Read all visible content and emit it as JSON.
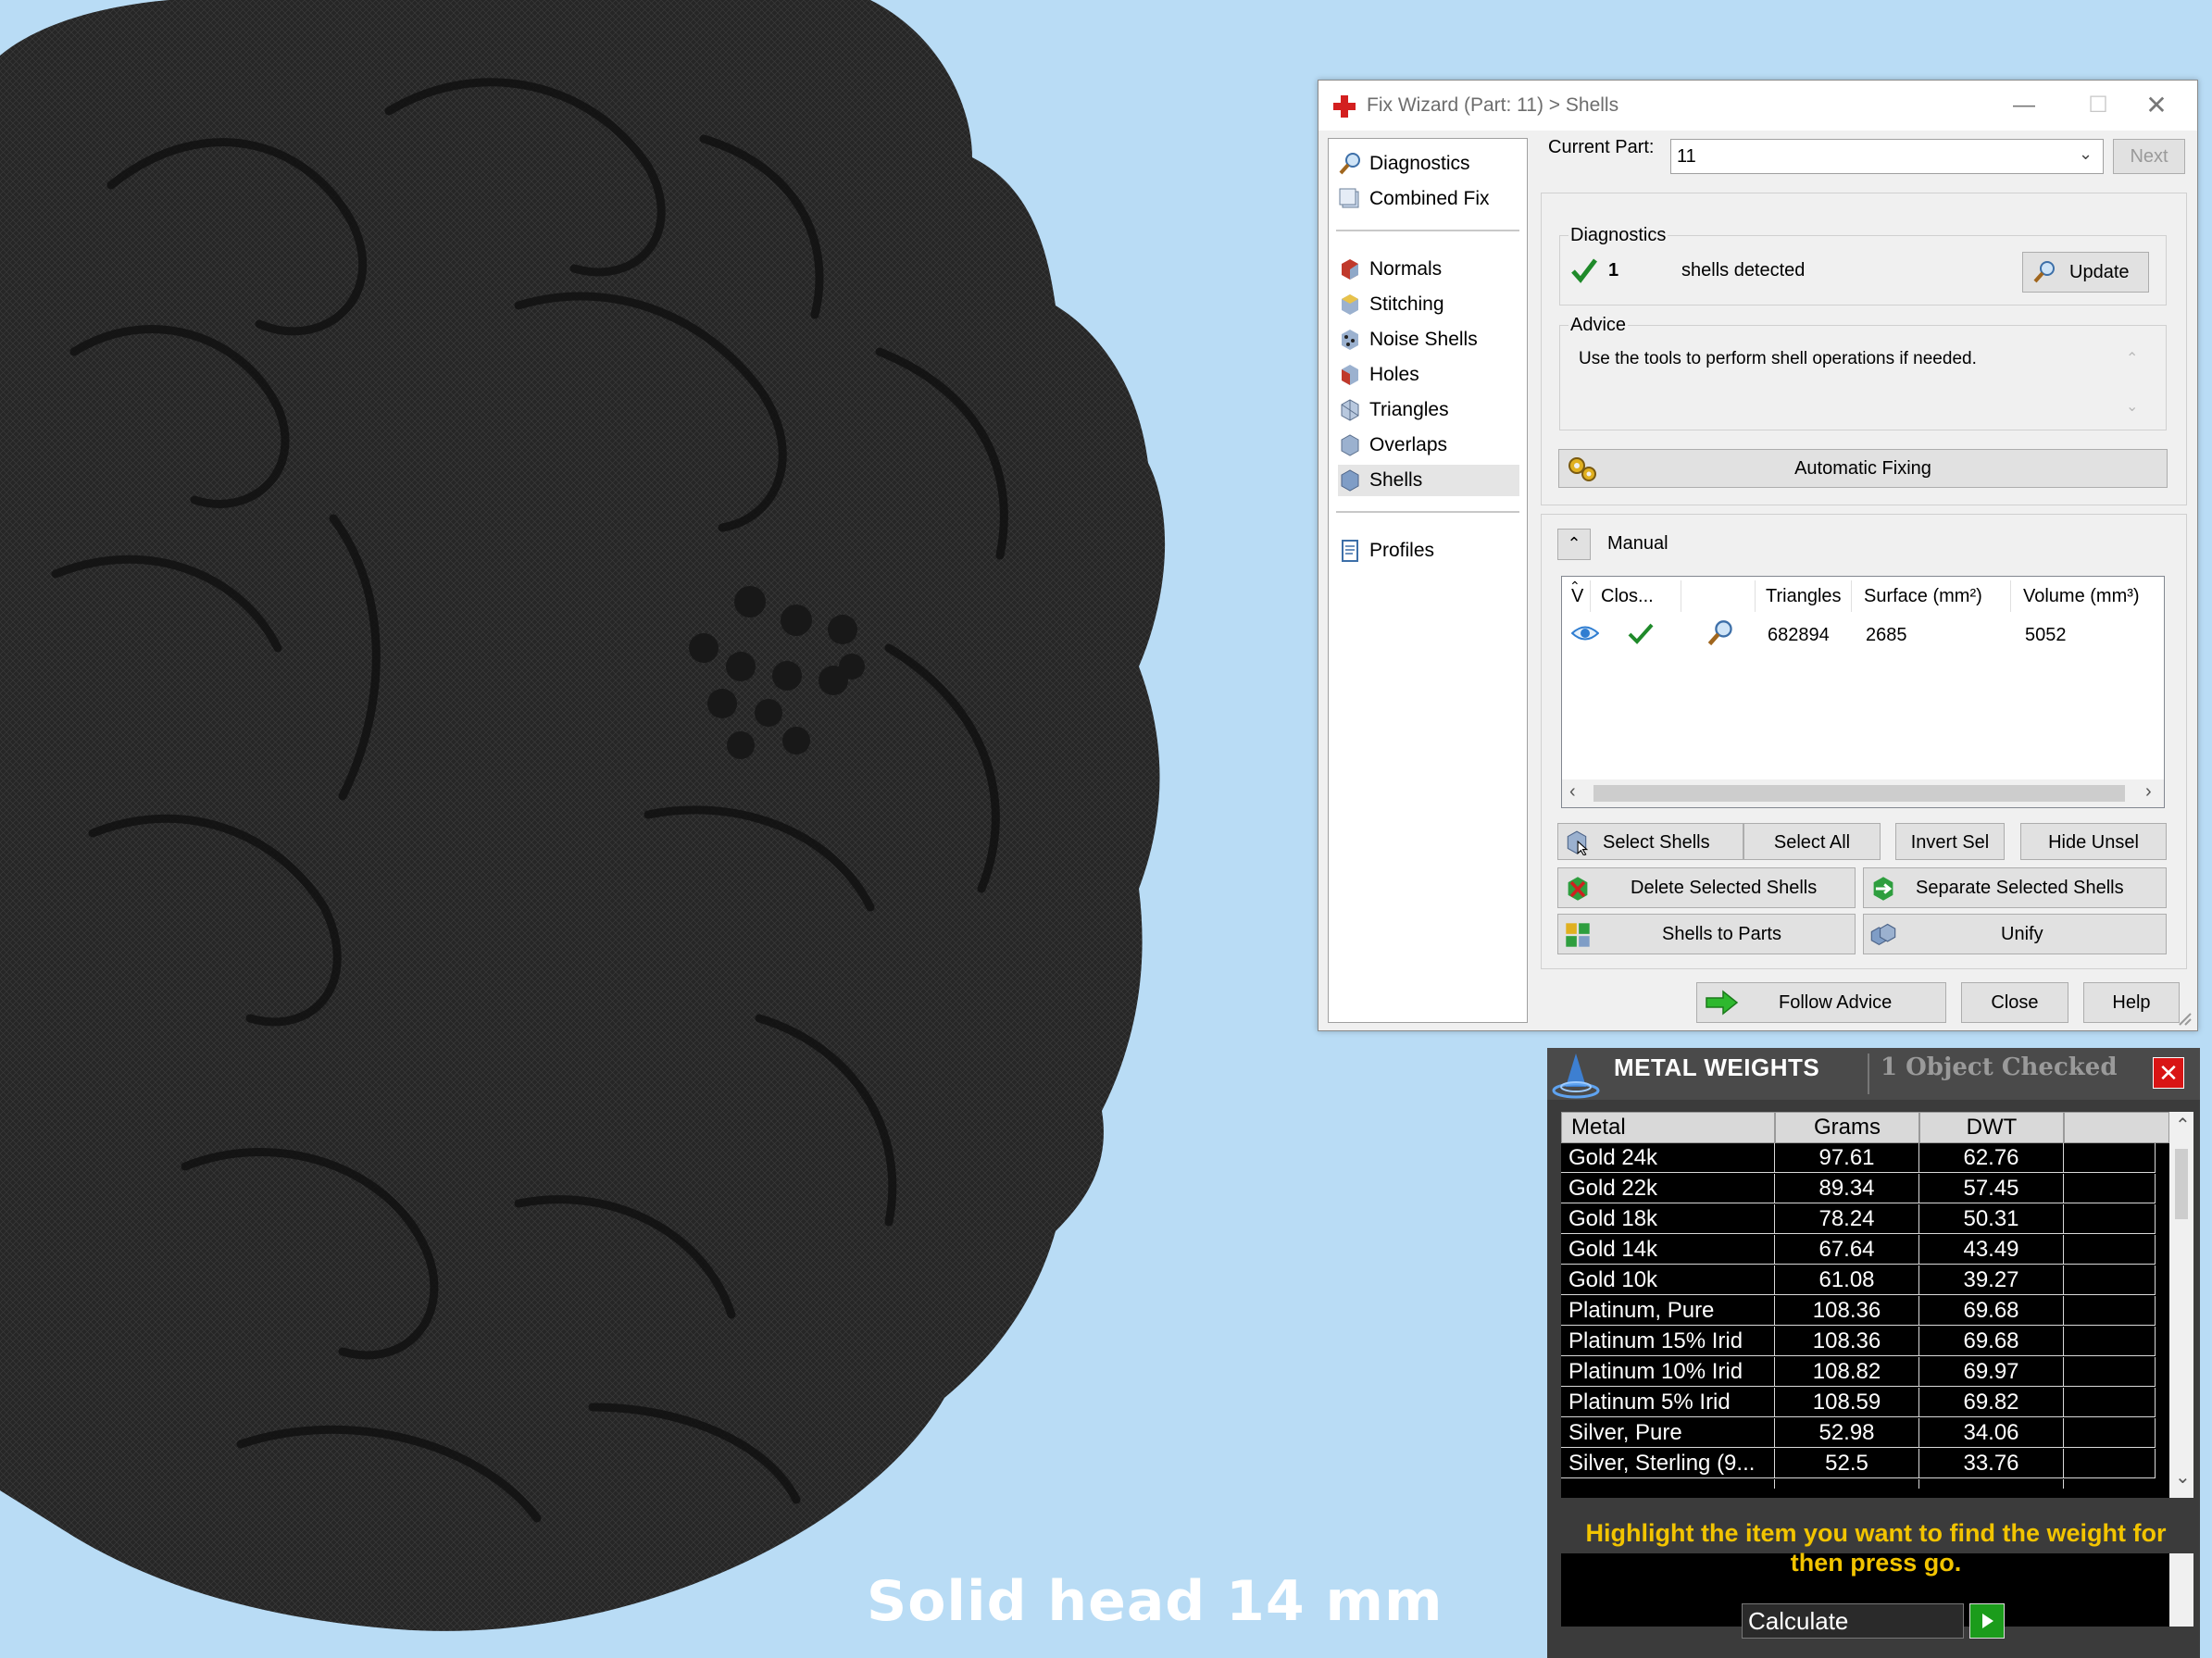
{
  "caption": "Solid head 14 mm",
  "wizard": {
    "title": "Fix Wizard (Part: 11) > Shells",
    "nav": {
      "diagnostics": "Diagnostics",
      "combined_fix": "Combined Fix",
      "normals": "Normals",
      "stitching": "Stitching",
      "noise_shells": "Noise Shells",
      "holes": "Holes",
      "triangles": "Triangles",
      "overlaps": "Overlaps",
      "shells": "Shells",
      "profiles": "Profiles"
    },
    "current_part_label": "Current Part:",
    "current_part_value": "11",
    "next_label": "Next",
    "diagnostics": {
      "title": "Diagnostics",
      "count": "1",
      "text": "shells detected",
      "update_label": "Update"
    },
    "advice": {
      "title": "Advice",
      "text": "Use the tools to perform shell operations if needed."
    },
    "automatic_fixing_label": "Automatic Fixing",
    "manual_label": "Manual",
    "grid": {
      "headers": [
        "V",
        "Clos...",
        "",
        "Triangles",
        "Surface (mm²)",
        "Volume (mm³)"
      ],
      "row": {
        "triangles": "682894",
        "surface": "2685",
        "volume": "5052"
      }
    },
    "buttons": {
      "select_shells": "Select Shells",
      "select_all": "Select All",
      "invert_sel": "Invert Sel",
      "hide_unsel": "Hide Unsel",
      "delete_selected": "Delete Selected Shells",
      "separate_selected": "Separate Selected Shells",
      "shells_to_parts": "Shells to Parts",
      "unify": "Unify",
      "follow_advice": "Follow Advice",
      "close": "Close",
      "help": "Help"
    }
  },
  "metal": {
    "title": "METAL WEIGHTS",
    "checked": "1 Object Checked",
    "headers": [
      "Metal",
      "Grams",
      "DWT"
    ],
    "rows": [
      [
        "Gold 24k",
        "97.61",
        "62.76"
      ],
      [
        "Gold 22k",
        "89.34",
        "57.45"
      ],
      [
        "Gold 18k",
        "78.24",
        "50.31"
      ],
      [
        "Gold 14k",
        "67.64",
        "43.49"
      ],
      [
        "Gold 10k",
        "61.08",
        "39.27"
      ],
      [
        "Platinum, Pure",
        "108.36",
        "69.68"
      ],
      [
        "Platinum 15% Irid",
        "108.36",
        "69.68"
      ],
      [
        "Platinum 10% Irid",
        "108.82",
        "69.97"
      ],
      [
        "Platinum 5% Irid",
        "108.59",
        "69.82"
      ],
      [
        "Silver, Pure",
        "52.98",
        "34.06"
      ],
      [
        "Silver, Sterling (9...",
        "52.5",
        "33.76"
      ]
    ],
    "message": "Highlight the item you want to find the weight for then press go.",
    "calculate_label": "Calculate"
  }
}
